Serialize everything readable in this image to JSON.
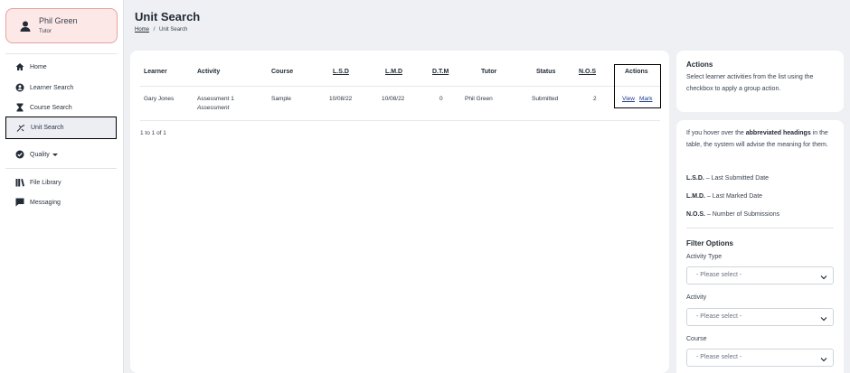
{
  "user": {
    "name": "Phil Green",
    "role": "Tutor"
  },
  "nav": {
    "home": "Home",
    "learner_search": "Learner Search",
    "course_search": "Course Search",
    "unit_search": "Unit Search",
    "quality": "Quality",
    "file_library": "File Library",
    "messaging": "Messaging"
  },
  "page": {
    "title": "Unit Search",
    "breadcrumb_home": "Home",
    "breadcrumb_sep": "/",
    "breadcrumb_current": "Unit Search"
  },
  "table": {
    "headers": {
      "learner": "Learner",
      "activity": "Activity",
      "course": "Course",
      "lsd": "L.S.D",
      "lmd": "L.M.D",
      "dtm": "D.T.M",
      "tutor": "Tutor",
      "status": "Status",
      "nos": "N.O.S",
      "actions": "Actions"
    },
    "rows": [
      {
        "learner": "Gary Jones",
        "activity": "Assessment 1",
        "activity_type": "Assessment",
        "course": "Sample",
        "lsd": "10/08/22",
        "lmd": "10/08/22",
        "dtm": "0",
        "tutor": "Phil Green",
        "status": "Submitted",
        "nos": "2",
        "view": "View",
        "mark": "Mark"
      }
    ],
    "pager": "1 to 1 of 1"
  },
  "actions_panel": {
    "title": "Actions",
    "text": "Select learner activities from the list using the checkbox to apply a group action."
  },
  "info_panel": {
    "intro_pre": "If you hover over the ",
    "intro_bold": "abbreviated headings",
    "intro_post": " in the table, the system will advise the meaning for them.",
    "lsd_abbr": "L.S.D.",
    "lsd_text": " – Last Submitted Date",
    "lmd_abbr": "L.M.D.",
    "lmd_text": " – Last Marked Date",
    "nos_abbr": "N.O.S.",
    "nos_text": " – Number of Submissions",
    "filter_title": "Filter Options",
    "activity_type_label": "Activity Type",
    "activity_label": "Activity",
    "course_label": "Course",
    "select_placeholder": "- Please select -"
  }
}
